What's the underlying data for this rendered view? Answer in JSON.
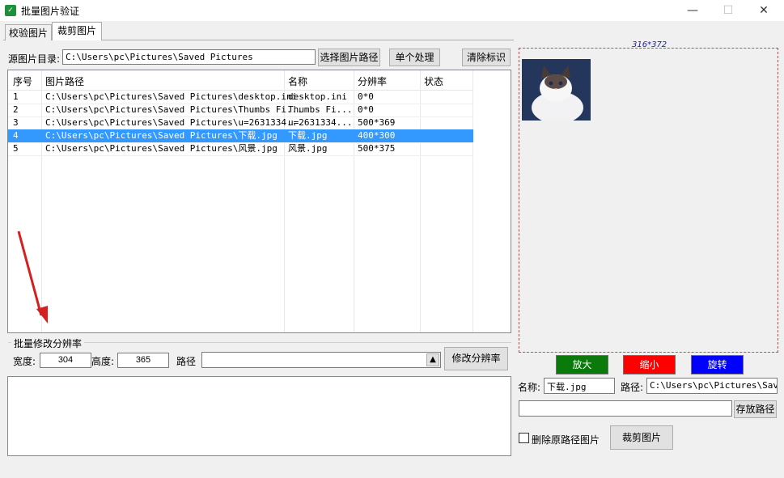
{
  "window": {
    "title": "批量图片验证",
    "minimize": "—",
    "maximize": "☐",
    "close": "✕"
  },
  "tabs": [
    "校验图片",
    "裁剪图片"
  ],
  "source": {
    "label": "源图片目录:",
    "path": "C:\\Users\\pc\\Pictures\\Saved Pictures",
    "choose_btn": "选择图片路径",
    "single_btn": "单个处理",
    "clear_btn": "清除标识"
  },
  "table": {
    "headers": [
      "序号",
      "图片路径",
      "名称",
      "分辨率",
      "状态"
    ],
    "rows": [
      {
        "no": "1",
        "path": "C:\\Users\\pc\\Pictures\\Saved Pictures\\desktop.ini",
        "name": "desktop.ini",
        "res": "0*0",
        "state": ""
      },
      {
        "no": "2",
        "path": "C:\\Users\\pc\\Pictures\\Saved Pictures\\Thumbs Fi...",
        "name": "Thumbs Fi...",
        "res": "0*0",
        "state": ""
      },
      {
        "no": "3",
        "path": "C:\\Users\\pc\\Pictures\\Saved Pictures\\u=2631334...",
        "name": "u=2631334...",
        "res": "500*369",
        "state": ""
      },
      {
        "no": "4",
        "path": "C:\\Users\\pc\\Pictures\\Saved Pictures\\下载.jpg",
        "name": "下载.jpg",
        "res": "400*300",
        "state": ""
      },
      {
        "no": "5",
        "path": "C:\\Users\\pc\\Pictures\\Saved Pictures\\风景.jpg",
        "name": "风景.jpg",
        "res": "500*375",
        "state": ""
      }
    ]
  },
  "batch": {
    "group_label": "批量修改分辨率",
    "width_label": "宽度:",
    "width_value": "304",
    "height_label": "高度:",
    "height_value": "365",
    "path_label": "路径",
    "path_value": "",
    "modify_btn": "修改分辨率"
  },
  "preview": {
    "size": "316*372"
  },
  "actions": {
    "zoom_in": "放大",
    "zoom_out": "缩小",
    "rotate": "旋转",
    "zoom_in_color": "#0a7a0a",
    "zoom_out_color": "#ff0000",
    "rotate_color": "#0000ff"
  },
  "output": {
    "name_label": "名称:",
    "name_value": "下载.jpg",
    "path_label": "路径:",
    "path_value": "C:\\Users\\pc\\Pictures\\Saved",
    "save_path_value": "",
    "save_path_btn": "存放路径",
    "delete_label": "删除原路径图片",
    "crop_btn": "裁剪图片"
  }
}
